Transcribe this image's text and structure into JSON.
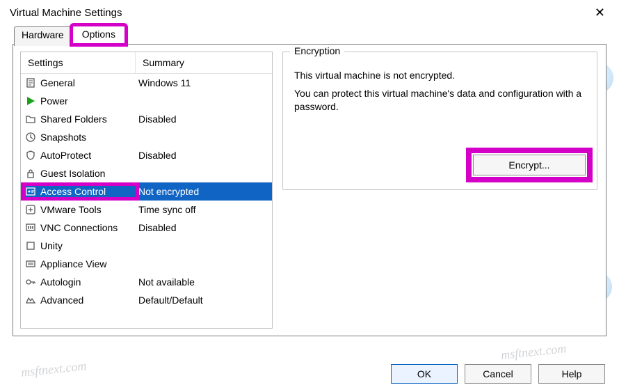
{
  "window": {
    "title": "Virtual Machine Settings"
  },
  "tabs": {
    "hardware": "Hardware",
    "options": "Options"
  },
  "list": {
    "head_settings": "Settings",
    "head_summary": "Summary",
    "items": [
      {
        "name": "General",
        "summary": "Windows 11",
        "icon": "doc"
      },
      {
        "name": "Power",
        "summary": "",
        "icon": "play"
      },
      {
        "name": "Shared Folders",
        "summary": "Disabled",
        "icon": "folder"
      },
      {
        "name": "Snapshots",
        "summary": "",
        "icon": "clock"
      },
      {
        "name": "AutoProtect",
        "summary": "Disabled",
        "icon": "shield"
      },
      {
        "name": "Guest Isolation",
        "summary": "",
        "icon": "lock"
      },
      {
        "name": "Access Control",
        "summary": "Not encrypted",
        "icon": "access",
        "selected": true
      },
      {
        "name": "VMware Tools",
        "summary": "Time sync off",
        "icon": "tools"
      },
      {
        "name": "VNC Connections",
        "summary": "Disabled",
        "icon": "vnc"
      },
      {
        "name": "Unity",
        "summary": "",
        "icon": "unity"
      },
      {
        "name": "Appliance View",
        "summary": "",
        "icon": "appliance"
      },
      {
        "name": "Autologin",
        "summary": "Not available",
        "icon": "key"
      },
      {
        "name": "Advanced",
        "summary": "Default/Default",
        "icon": "adv"
      }
    ]
  },
  "panel": {
    "group_title": "Encryption",
    "line1": "This virtual machine is not encrypted.",
    "line2": "You can protect this virtual machine's data and configuration with a password.",
    "encrypt_btn": "Encrypt..."
  },
  "footer": {
    "ok": "OK",
    "cancel": "Cancel",
    "help": "Help"
  },
  "highlights": {
    "options_tab": true,
    "access_control_row": true,
    "encrypt_button": true
  }
}
